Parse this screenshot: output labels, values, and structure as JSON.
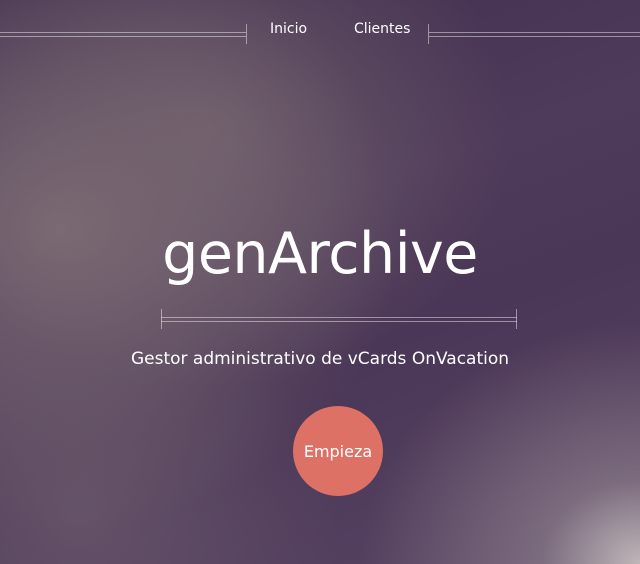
{
  "nav": {
    "links": [
      {
        "label": "Inicio"
      },
      {
        "label": "Clientes"
      }
    ]
  },
  "hero": {
    "title": "genArchive",
    "subtitle": "Gestor administrativo de vCards OnVacation",
    "cta_label": "Empieza"
  },
  "colors": {
    "cta_background": "#de7165",
    "background_dark": "#4a3656",
    "text": "#ffffff"
  }
}
